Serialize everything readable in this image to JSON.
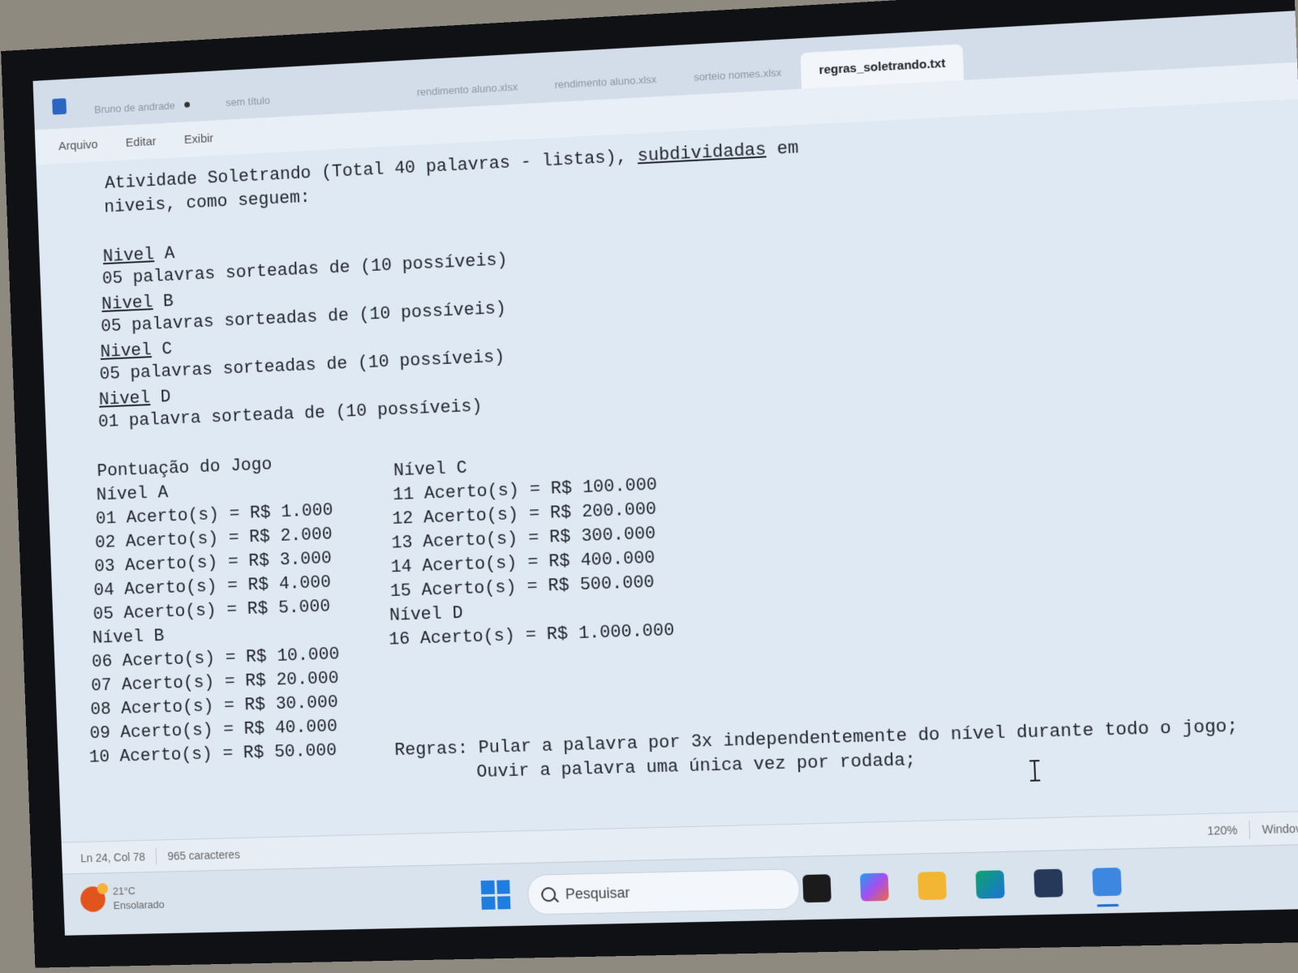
{
  "window": {
    "tabs": [
      {
        "label": "Bruno de andrade",
        "active": false
      },
      {
        "label": "sem título",
        "active": false
      },
      {
        "label": "rendimento aluno.xlsx",
        "active": false
      },
      {
        "label": "rendimento aluno.xlsx",
        "active": false
      },
      {
        "label": "sorteio nomes.xlsx",
        "active": false
      },
      {
        "label": "regras_soletrando.txt",
        "active": true
      }
    ]
  },
  "menu": {
    "file": "Arquivo",
    "edit": "Editar",
    "view": "Exibir"
  },
  "editor": {
    "intro_1": "Atividade Soletrando (Total 40 palavras - listas), ",
    "intro_1_emph": "subdividadas",
    "intro_1_end": " em",
    "intro_2": "niveis, como seguem:",
    "levels": [
      {
        "word": "Nivel",
        "letter": " A",
        "desc": "05 palavras sorteadas de (10 possíveis)"
      },
      {
        "word": "Nivel",
        "letter": " B",
        "desc": "05 palavras sorteadas de (10 possíveis)"
      },
      {
        "word": "Nivel",
        "letter": " C",
        "desc": "05 palavras sorteadas de (10 possíveis)"
      },
      {
        "word": "Nivel",
        "letter": " D",
        "desc": "01 palavra sorteada de (10 possíveis)"
      }
    ],
    "score_title": "Pontuação do Jogo",
    "score_left": [
      "Nível A",
      "01 Acerto(s) = R$ 1.000",
      "02 Acerto(s) = R$ 2.000",
      "03 Acerto(s) = R$ 3.000",
      "04 Acerto(s) = R$ 4.000",
      "05 Acerto(s) = R$ 5.000",
      "Nível B",
      "06 Acerto(s) = R$ 10.000",
      "07 Acerto(s) = R$ 20.000",
      "08 Acerto(s) = R$ 30.000",
      "09 Acerto(s) = R$ 40.000",
      "10 Acerto(s) = R$ 50.000"
    ],
    "score_right": [
      "Nível C",
      "11 Acerto(s) = R$ 100.000",
      "12 Acerto(s) = R$ 200.000",
      "13 Acerto(s) = R$ 300.000",
      "14 Acerto(s) = R$ 400.000",
      "15 Acerto(s) = R$ 500.000",
      "Nível D",
      "16 Acerto(s) = R$ 1.000.000"
    ],
    "rules_1": "Regras: Pular a palavra por 3x independentemente do nível durante todo o jogo;",
    "rules_2": "Ouvir a palavra uma única vez por rodada;"
  },
  "status": {
    "position": "Ln 24, Col 78",
    "chars": "965 caracteres",
    "zoom": "120%",
    "line_ending": "Windows"
  },
  "taskbar": {
    "weather_temp": "21°C",
    "weather_desc": "Ensolarado",
    "search_placeholder": "Pesquisar"
  },
  "icons": [
    "notepad-icon",
    "windows-start-icon",
    "search-icon",
    "task-view-icon",
    "copilot-icon",
    "file-explorer-icon",
    "edge-icon",
    "store-icon",
    "notepad-taskbar-icon",
    "weather-icon"
  ]
}
